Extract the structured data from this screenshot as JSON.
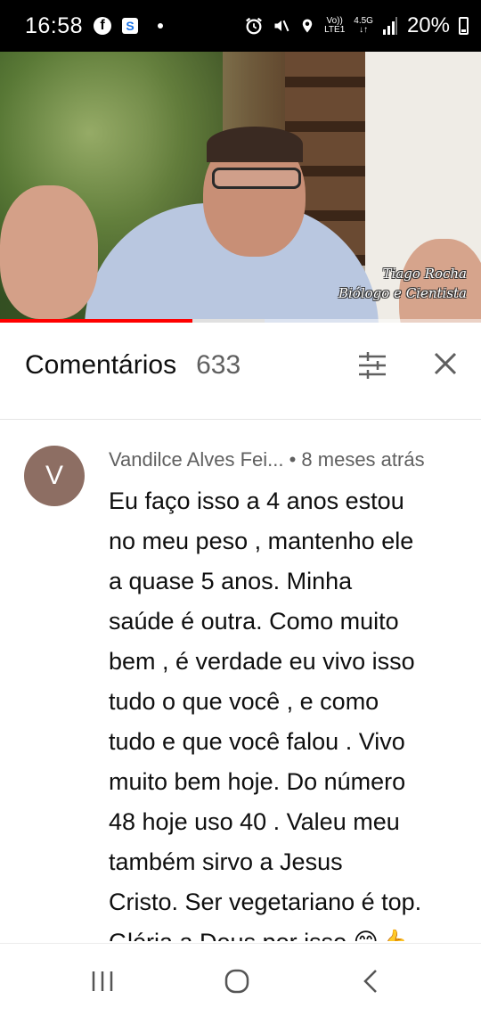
{
  "status_bar": {
    "time": "16:58",
    "battery": "20%",
    "volte_top": "Vo))",
    "volte_bottom": "LTE1",
    "net_top": "4.5G",
    "net_bottom": "↓↑"
  },
  "video": {
    "caption_name": "Tiago Rocha",
    "caption_title": "Biólogo e Cientista",
    "progress": 0.4
  },
  "comments": {
    "title": "Comentários",
    "count": "633"
  },
  "comment": {
    "avatar_letter": "V",
    "author": "Vandilce Alves Fei...",
    "time": "• 8 meses atrás",
    "text": "Eu faço isso a 4 anos estou\nno meu peso , mantenho ele\na quase 5 anos. Minha\nsaúde é outra. Como muito\nbem , é verdade eu vivo isso\ntudo o que você , e como\ntudo e que você falou . Vivo\nmuito bem hoje. Do número\n48 hoje uso 40  . Valeu meu\ntambém sirvo a Jesus\nCristo. Ser vegetariano é top.\nGlória a Deus por isso 😁👍"
  },
  "icons": {
    "status_bar": [
      "facebook-icon",
      "s-app-icon",
      "alarm-icon",
      "mute-icon",
      "location-icon",
      "signal-icon",
      "battery-icon"
    ],
    "header": [
      "filter-icon",
      "close-icon"
    ],
    "navbar": [
      "recent-apps-icon",
      "home-icon",
      "back-icon"
    ]
  },
  "colors": {
    "accent": "#ff0000",
    "avatar": "#8d6e63"
  }
}
